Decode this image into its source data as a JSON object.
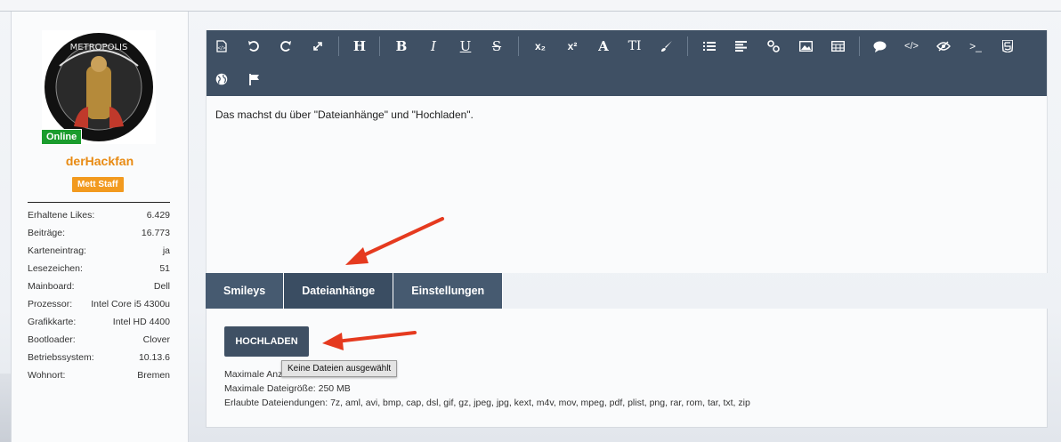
{
  "user": {
    "online_badge": "Online",
    "name": "derHackfan",
    "rank": "Mett Staff",
    "avatar_alt": "DER METROPOLIS HACKFAN",
    "stats": [
      {
        "label": "Erhaltene Likes:",
        "value": "6.429"
      },
      {
        "label": "Beiträge:",
        "value": "16.773"
      },
      {
        "label": "Karteneintrag:",
        "value": "ja"
      },
      {
        "label": "Lesezeichen:",
        "value": "51"
      },
      {
        "label": "Mainboard:",
        "value": "Dell"
      },
      {
        "label": "Prozessor:",
        "value": "Intel Core i5 4300u"
      },
      {
        "label": "Grafikkarte:",
        "value": "Intel HD 4400"
      },
      {
        "label": "Bootloader:",
        "value": "Clover"
      },
      {
        "label": "Betriebssystem:",
        "value": "10.13.6"
      },
      {
        "label": "Wohnort:",
        "value": "Bremen"
      }
    ]
  },
  "toolbar": {
    "heading": "H",
    "bold": "B",
    "italic": "I",
    "underline": "U",
    "strike": "S",
    "subscript": "x₂",
    "superscript": "x²",
    "font_size": "A",
    "font_family": "TI"
  },
  "editor": {
    "content": "Das machst du über \"Dateianhänge\" und \"Hochladen\"."
  },
  "tabs": [
    "Smileys",
    "Dateianhänge",
    "Einstellungen"
  ],
  "attachments": {
    "upload_button": "HOCHLADEN",
    "tooltip": "Keine Dateien ausgewählt",
    "max_count": "Maximale Anz",
    "max_size": "Maximale Dateigröße: 250 MB",
    "extensions": "Erlaubte Dateiendungen: 7z, aml, avi, bmp, cap, dsl, gif, gz, jpeg, jpg, kext, m4v, mov, mpeg, pdf, plist, png, rar, rom, tar, txt, zip"
  },
  "colors": {
    "toolbar": "#3f5064",
    "accent_orange": "#f29a1f",
    "online_green": "#1a9c2d",
    "arrow_red": "#e53a1f"
  }
}
